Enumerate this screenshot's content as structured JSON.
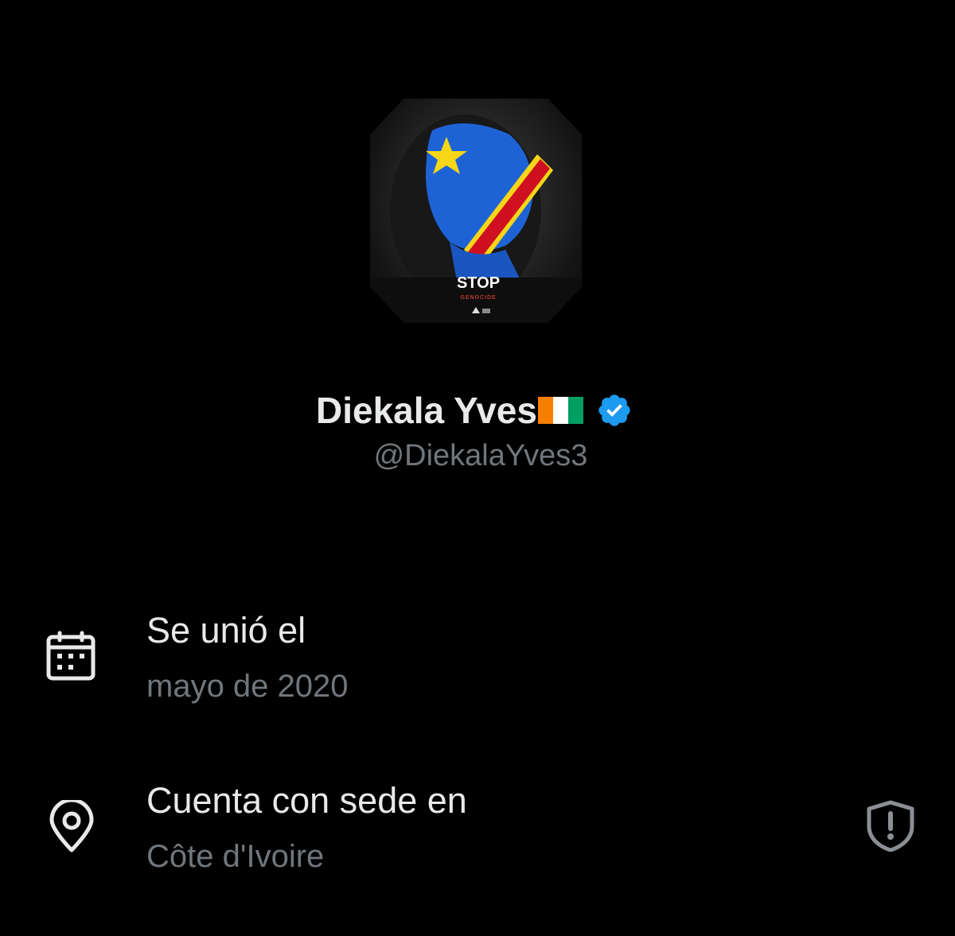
{
  "profile": {
    "display_name": "Diekala Yves",
    "flag_emoji": "🇨🇮",
    "verified": true,
    "handle": "@DiekalaYves3",
    "avatar": {
      "caption_main": "STOP",
      "caption_sub": "GENOCIDE"
    }
  },
  "about": {
    "joined": {
      "icon": "calendar-icon",
      "title": "Se unió el",
      "value": "mayo de 2020"
    },
    "location": {
      "icon": "location-pin-icon",
      "title": "Cuenta con sede en",
      "value": "Côte d'Ivoire",
      "action_icon": "shield-alert-icon"
    }
  },
  "colors": {
    "background": "#000000",
    "primary_text": "#e7e9ea",
    "secondary_text": "#71767b",
    "verified_blue": "#1d9bf0",
    "flag_orange": "#f77f00",
    "flag_green": "#009e60"
  }
}
